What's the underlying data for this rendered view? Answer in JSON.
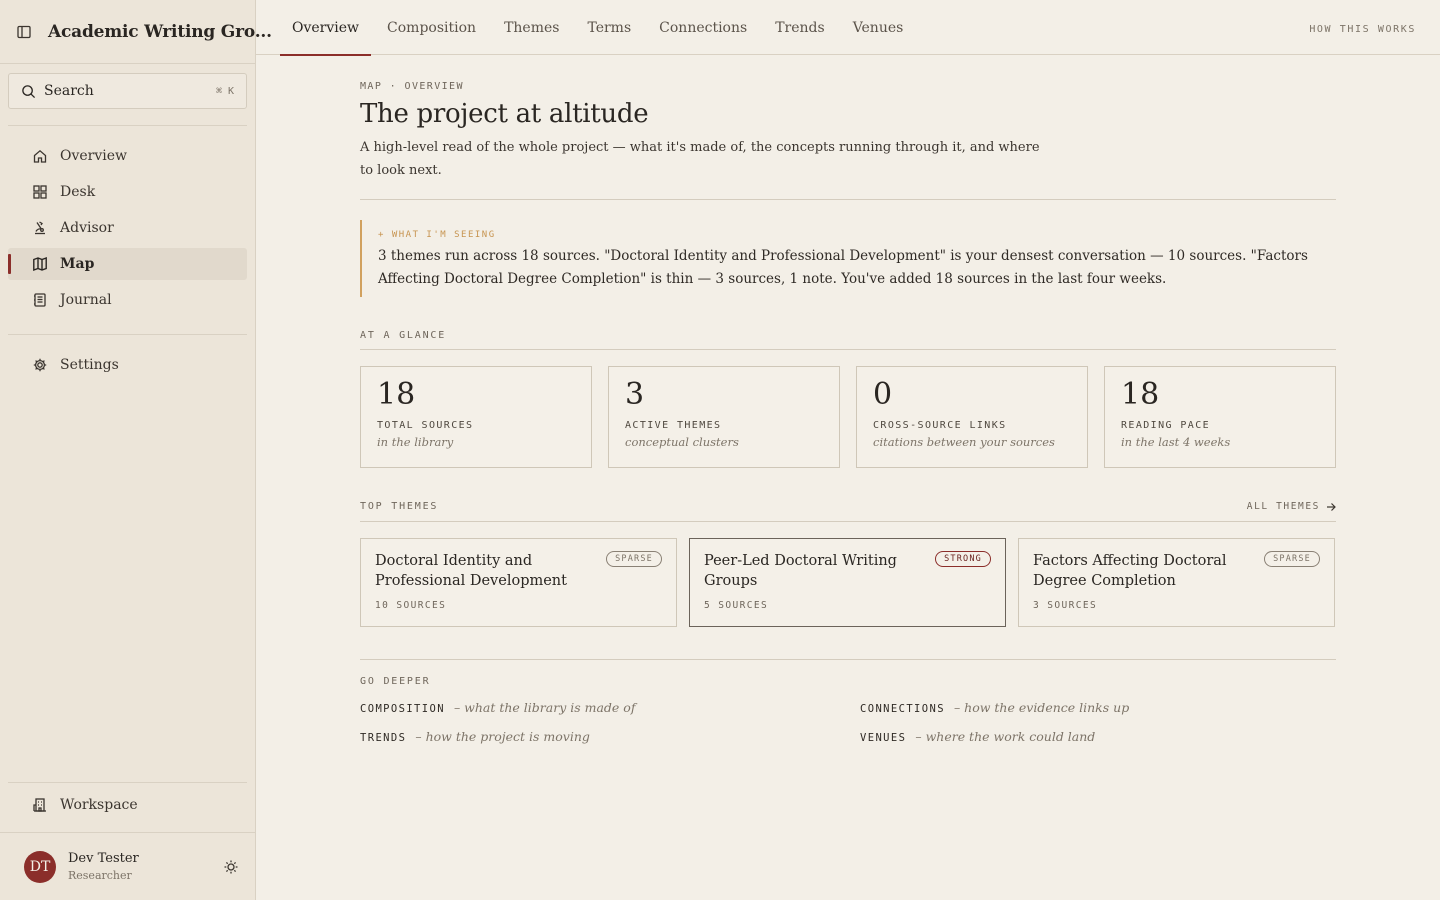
{
  "app": {
    "title": "Academic Writing Gro..."
  },
  "search": {
    "label": "Search",
    "shortcut": "⌘ K"
  },
  "sidebar": {
    "items": [
      {
        "label": "Overview",
        "icon": "home-icon"
      },
      {
        "label": "Desk",
        "icon": "grid-icon"
      },
      {
        "label": "Advisor",
        "icon": "advisor-icon"
      },
      {
        "label": "Map",
        "icon": "map-icon",
        "active": true
      },
      {
        "label": "Journal",
        "icon": "journal-icon"
      }
    ],
    "settings": "Settings",
    "workspace": "Workspace"
  },
  "user": {
    "initials": "DT",
    "name": "Dev Tester",
    "role": "Researcher"
  },
  "tabs": [
    "Overview",
    "Composition",
    "Themes",
    "Terms",
    "Connections",
    "Trends",
    "Venues"
  ],
  "how_link": "HOW THIS WORKS",
  "page": {
    "eyebrow": "MAP · OVERVIEW",
    "title": "The project at altitude",
    "lede": "A high-level read of the whole project — what it's made of, the concepts running through it, and where to look next."
  },
  "callout": {
    "tag": "+ WHAT I'M SEEING",
    "text": "3 themes run across 18 sources. \"Doctoral Identity and Professional Development\" is your densest conversation — 10 sources. \"Factors Affecting Doctoral Degree Completion\" is thin — 3 sources, 1 note. You've added 18 sources in the last four weeks."
  },
  "glance": {
    "label": "AT A GLANCE",
    "stats": [
      {
        "value": "18",
        "label": "TOTAL SOURCES",
        "sub": "in the library"
      },
      {
        "value": "3",
        "label": "ACTIVE THEMES",
        "sub": "conceptual clusters"
      },
      {
        "value": "0",
        "label": "CROSS-SOURCE LINKS",
        "sub": "citations between your sources"
      },
      {
        "value": "18",
        "label": "READING PACE",
        "sub": "in the last 4 weeks"
      }
    ]
  },
  "top_themes": {
    "label": "TOP THEMES",
    "all_link": "ALL THEMES",
    "items": [
      {
        "title": "Doctoral Identity and Professional Development",
        "badge": "SPARSE",
        "count": "10 SOURCES"
      },
      {
        "title": "Peer-Led Doctoral Writing Groups",
        "badge": "STRONG",
        "count": "5 SOURCES"
      },
      {
        "title": "Factors Affecting Doctoral Degree Completion",
        "badge": "SPARSE",
        "count": "3 SOURCES"
      }
    ]
  },
  "go_deeper": {
    "label": "GO DEEPER",
    "links": [
      {
        "key": "COMPOSITION",
        "desc": "– what the library is made of"
      },
      {
        "key": "CONNECTIONS",
        "desc": "– how the evidence links up"
      },
      {
        "key": "TRENDS",
        "desc": "– how the project is moving"
      },
      {
        "key": "VENUES",
        "desc": "– where the work could land"
      }
    ]
  },
  "colors": {
    "accent": "#8b2e2a",
    "background": "#f3efe7",
    "sidebar": "#ece5d9",
    "callout_border": "#d1a15f"
  }
}
